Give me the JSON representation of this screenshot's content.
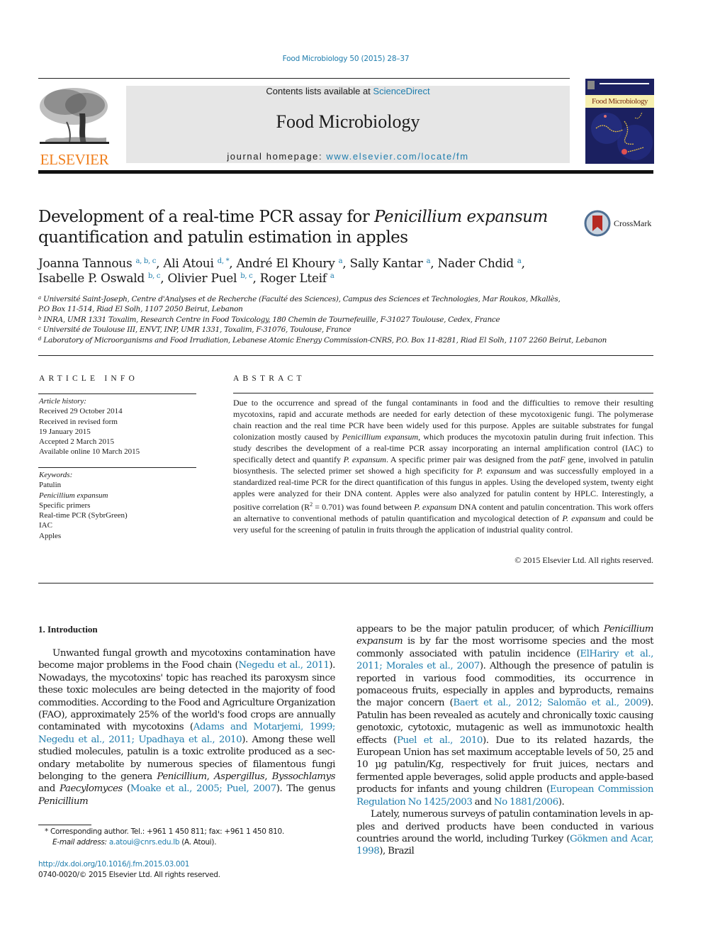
{
  "header": {
    "journal_ref": "Food Microbiology 50 (2015) 28–37",
    "publisher_logo_text": "ELSEVIER",
    "contents_prefix": "Contents lists available at ",
    "contents_link": "ScienceDirect",
    "journal_title": "Food Microbiology",
    "homepage_prefix": "journal homepage: ",
    "homepage_link": "www.elsevier.com/locate/fm",
    "cover_title": "Food Microbiology",
    "crossmark_label": "CrossMark"
  },
  "article": {
    "title_part1": "Development of a real-time PCR assay for ",
    "title_italic": "Penicillium expansum",
    "title_part2": " quantification and patulin estimation in apples",
    "authors": [
      {
        "name": "Joanna Tannous",
        "aff": "a, b, c"
      },
      {
        "name": "Ali Atoui",
        "aff": "d, *"
      },
      {
        "name": "André El Khoury",
        "aff": "a"
      },
      {
        "name": "Sally Kantar",
        "aff": "a"
      },
      {
        "name": "Nader Chdid",
        "aff": "a"
      },
      {
        "name": "Isabelle P. Oswald",
        "aff": "b, c"
      },
      {
        "name": "Olivier Puel",
        "aff": "b, c"
      },
      {
        "name": "Roger Lteif",
        "aff": "a"
      }
    ],
    "affiliations": [
      {
        "key": "a",
        "text": "Université Saint-Joseph, Centre d'Analyses et de Recherche (Faculté des Sciences), Campus des Sciences et Technologies, Mar Roukos, Mkallès,",
        "text2": "P.O Box 11-514, Riad El Solh, 1107 2050 Beirut, Lebanon"
      },
      {
        "key": "b",
        "text": "INRA, UMR 1331 Toxalim, Research Centre in Food Toxicology, 180 Chemin de Tournefeuille, F-31027 Toulouse, Cedex, France"
      },
      {
        "key": "c",
        "text": "Université de Toulouse III, ENVT, INP, UMR 1331, Toxalim, F-31076, Toulouse, France"
      },
      {
        "key": "d",
        "text": "Laboratory of Microorganisms and Food Irradiation, Lebanese Atomic Energy Commission-CNRS, P.O. Box 11-8281, Riad El Solh, 1107 2260 Beirut, Lebanon"
      }
    ]
  },
  "article_info": {
    "heading": "ARTICLE INFO",
    "history_label": "Article history:",
    "history": [
      "Received 29 October 2014",
      "Received in revised form",
      "19 January 2015",
      "Accepted 2 March 2015",
      "Available online 10 March 2015"
    ],
    "keywords_label": "Keywords:",
    "keywords": [
      "Patulin",
      "Penicillium expansum",
      "Specific primers",
      "Real-time PCR (SybrGreen)",
      "IAC",
      "Apples"
    ]
  },
  "abstract": {
    "heading": "ABSTRACT",
    "s1": "Due to the occurrence and spread of the fungal contaminants in food and the difficulties to remove their resulting mycotoxins, rapid and accurate methods are needed for early detection of these mycotoxigenic fungi. The polymerase chain reaction and the real time PCR have been widely used for this purpose. Apples are suitable substrates for fungal colonization mostly caused by ",
    "i1": "Penicillium expansum",
    "s2": ", which produces the mycotoxin patulin during fruit infection. This study describes the development of a real-time PCR assay incorporating an internal amplification control (IAC) to specifically detect and quantify ",
    "i2": "P. expansum",
    "s3": ". A specific primer pair was designed from the ",
    "i3": "patF",
    "s4": " gene, involved in patulin biosynthesis. The selected primer set showed a high specificity for ",
    "i4": "P. expansum",
    "s5": " and was successfully employed in a standardized real-time PCR for the direct quantification of this fungus in apples. Using the developed system, twenty eight apples were analyzed for their DNA content. Apples were also analyzed for patulin content by HPLC. Interestingly, a positive correlation (R",
    "sup": "2",
    "s6": " = 0.701) was found between ",
    "i5": "P. expansum",
    "s7": " DNA content and patulin concentration. This work offers an alternative to conventional methods of patulin quantification and mycological detection of ",
    "i6": "P. expansum",
    "s8": " and could be very useful for the screening of patulin in fruits through the application of industrial quality control.",
    "copyright": "© 2015 Elsevier Ltd. All rights reserved."
  },
  "intro": {
    "heading": "1.  Introduction",
    "left": {
      "t1": "Unwanted fungal growth and mycotoxins contamination have become major problems in the Food chain (",
      "c1": "Negedu et al., 2011",
      "t2": "). Nowadays, the mycotoxins' topic has reached its paroxysm since these toxic molecules are being detected in the majority of food commodities. According to the Food and Agriculture Organization (FAO), approximately 25% of the world's food crops are annually contaminated with mycotoxins (",
      "c2": "Adams and Motarjemi, 1999; Negedu et al., 2011; Upadhaya et al., 2010",
      "t3": "). Among these well studied molecules, patulin is a toxic extrolite produced as a sec­ondary metabolite by numerous species of filamentous fungi belonging to the genera ",
      "i1": "Penicillium",
      "t4": ", ",
      "i2": "Aspergillus",
      "t5": ", ",
      "i3": "Byssochlamys",
      "t6": " and ",
      "i4": "Paecylomyces",
      "t7": " (",
      "c3": "Moake et al., 2005; Puel, 2007",
      "t8": "). The genus ",
      "i5": "Penicillium"
    },
    "right": {
      "t1": "appears to be the major patulin producer, of which ",
      "i1": "Penicillium expansum",
      "t2": " is by far the most worrisome species and the most commonly associated with patulin incidence (",
      "c1": "ElHariry et al., 2011; Morales et al., 2007",
      "t3": "). Although the presence of patulin is reported in various food commodities, its occurrence in pomaceous fruits, especially in apples and byproducts, remains the major concern (",
      "c2": "Baert et al., 2012; Salomão et al., 2009",
      "t4": "). Patulin has been revealed as acutely and chronically toxic causing genotoxic, cytotoxic, mutagenic as well as immunotoxic health effects (",
      "c3": "Puel et al., 2010",
      "t5": "). Due to its related hazards, the European Union has set maximum acceptable levels of 50, 25 and 10 µg patulin/Kg, respectively for fruit juices, nectars and fermented apple beverages, solid apple products and apple-based products for infants and young children (",
      "c4": "European Commission Regulation No 1425/2003",
      "t6": " and ",
      "c5": "No 1881/2006",
      "t7": ").",
      "p2": "Lately, numerous surveys of patulin contamination levels in ap­ples and derived products have been conducted in various countries around the world, including Turkey (",
      "c6": "Gökmen and Acar, 1998",
      "p2b": "), Brazil"
    }
  },
  "footnotes": {
    "corresponding": "* Corresponding author. Tel.: +961 1 450 811; fax: +961 1 450 810.",
    "email_label": "E-mail address: ",
    "email": "a.atoui@cnrs.edu.lb",
    "email_suffix": " (A. Atoui).",
    "doi": "http://dx.doi.org/10.1016/j.fm.2015.03.001",
    "issn": "0740-0020/© 2015 Elsevier Ltd. All rights reserved."
  },
  "colors": {
    "link": "#1f7dad",
    "elsevier_orange": "#f07f1d",
    "masthead_gray": "#e6e6e6"
  }
}
